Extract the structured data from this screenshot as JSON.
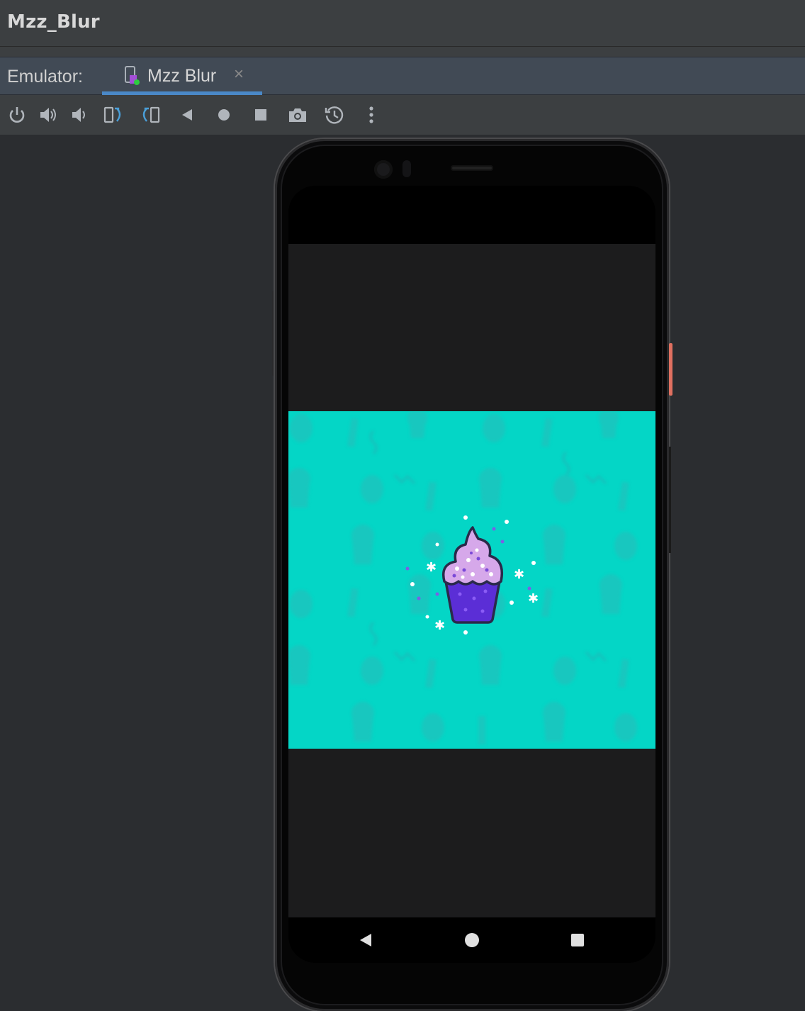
{
  "window": {
    "title": "Mzz_Blur"
  },
  "tabbar": {
    "label": "Emulator:",
    "tab": {
      "label": "Mzz Blur",
      "close_glyph": "×",
      "icon": "device-icon"
    }
  },
  "toolbar": {
    "buttons": [
      {
        "name": "power-button",
        "icon": "power-icon"
      },
      {
        "name": "volume-up-button",
        "icon": "volume-up-icon"
      },
      {
        "name": "volume-down-button",
        "icon": "volume-down-icon"
      },
      {
        "name": "rotate-left-button",
        "icon": "rotate-left-icon"
      },
      {
        "name": "rotate-right-button",
        "icon": "rotate-right-icon"
      },
      {
        "name": "back-button",
        "icon": "back-icon"
      },
      {
        "name": "home-button",
        "icon": "home-icon"
      },
      {
        "name": "overview-button",
        "icon": "overview-icon"
      },
      {
        "name": "screenshot-button",
        "icon": "camera-icon"
      },
      {
        "name": "snapshot-button",
        "icon": "snapshot-icon"
      },
      {
        "name": "more-button",
        "icon": "more-icon"
      }
    ]
  },
  "device": {
    "app_image": {
      "subject": "cupcake-icon",
      "background": "#04d6c6"
    },
    "nav_bar": [
      "nav-back-icon",
      "nav-home-icon",
      "nav-recents-icon"
    ]
  },
  "colors": {
    "accent": "#4a88c7",
    "cyan": "#04d6c6",
    "frosting": "#d6a8ea",
    "cup": "#6a2ed8"
  }
}
